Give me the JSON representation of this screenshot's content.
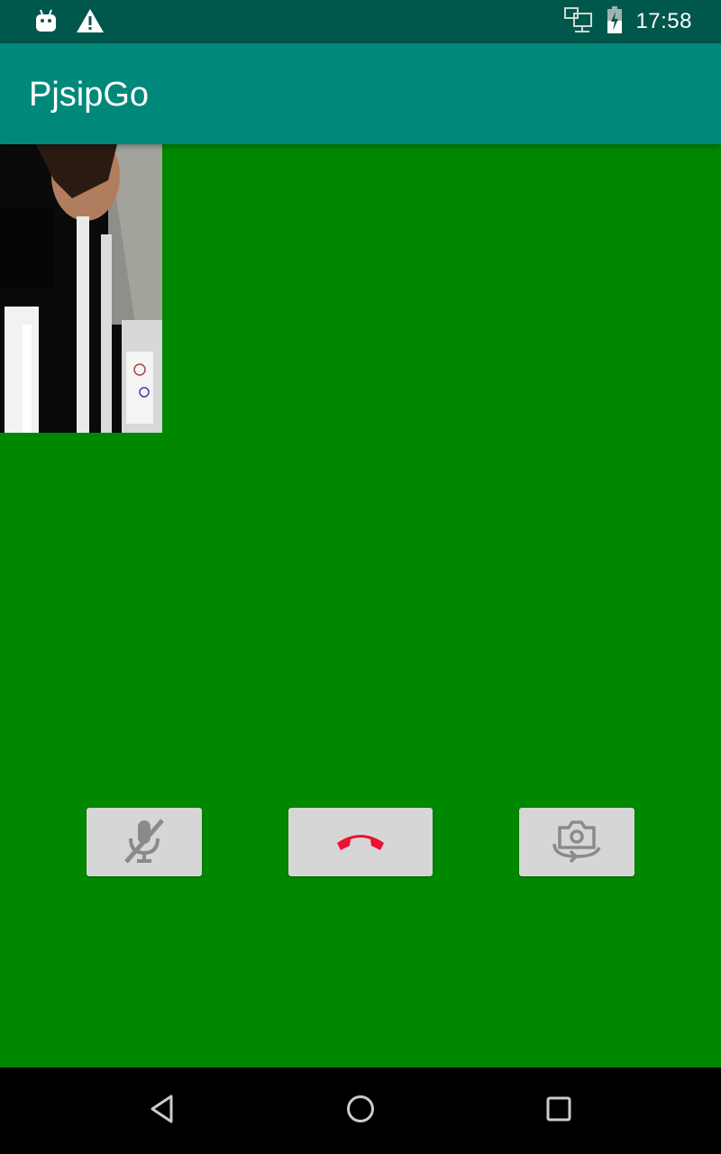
{
  "status_bar": {
    "time": "17:58",
    "left_icons": [
      "android-notification-icon",
      "warning-icon"
    ],
    "right_icons": [
      "ethernet-icon",
      "battery-charging-icon"
    ]
  },
  "app_bar": {
    "title": "PjsipGo"
  },
  "call": {
    "background_color": "#008800",
    "local_preview": "camera-preview",
    "buttons": [
      {
        "name": "mute-button",
        "icon": "mic-off-icon"
      },
      {
        "name": "hangup-button",
        "icon": "call-end-icon",
        "icon_color": "#ee1133"
      },
      {
        "name": "switch-camera-button",
        "icon": "switch-camera-icon"
      }
    ]
  },
  "nav_bar": {
    "buttons": [
      "back-icon",
      "home-icon",
      "recents-icon"
    ]
  }
}
